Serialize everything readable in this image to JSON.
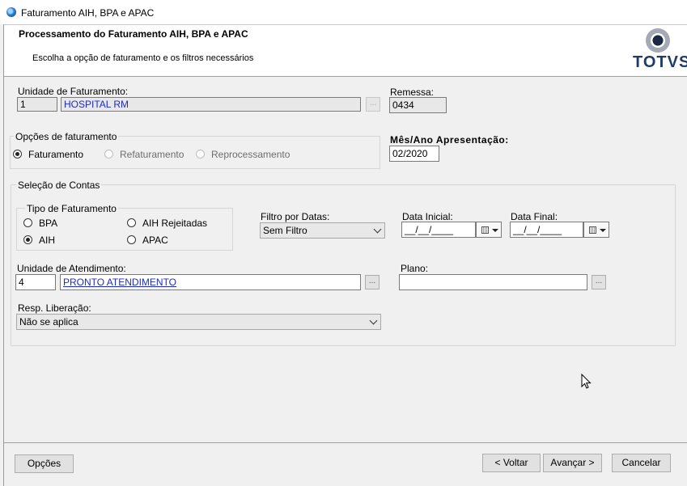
{
  "window": {
    "title": "Faturamento AIH, BPA e APAC",
    "app_icon": "totvs-app-icon"
  },
  "header": {
    "title": "Processamento do Faturamento AIH, BPA e APAC",
    "subtitle": "Escolha a opção de faturamento e os filtros necessários",
    "logo_text": "TOTVS",
    "logo_color": "#1f3b66"
  },
  "unidade_faturamento": {
    "label": "Unidade de Faturamento:",
    "code": "1",
    "name": "HOSPITAL RM",
    "lookup_label": "..."
  },
  "remessa": {
    "label": "Remessa:",
    "value": "0434"
  },
  "opcoes_faturamento": {
    "title": "Opções de faturamento",
    "options": [
      "Faturamento",
      "Refaturamento",
      "Reprocessamento"
    ],
    "selected": "Faturamento"
  },
  "mes_ano": {
    "label": "Mês/Ano Apresentação:",
    "value": "02/2020"
  },
  "selecao_contas": {
    "title": "Seleção de Contas",
    "tipo_faturamento": {
      "title": "Tipo de Faturamento",
      "options": [
        "BPA",
        "AIH Rejeitadas",
        "AIH",
        "APAC"
      ],
      "selected": "AIH"
    },
    "filtro_datas": {
      "label": "Filtro por Datas:",
      "value": "Sem Filtro"
    },
    "data_inicial": {
      "label": "Data Inicial:",
      "value": "__/__/____"
    },
    "data_final": {
      "label": "Data Final:",
      "value": "__/__/____"
    },
    "unidade_atendimento": {
      "label": "Unidade de Atendimento:",
      "code": "4",
      "name": "PRONTO ATENDIMENTO",
      "lookup_label": "..."
    },
    "plano": {
      "label": "Plano:",
      "value": "",
      "lookup_label": "..."
    },
    "resp_liberacao": {
      "label": "Resp. Liberação:",
      "value": "Não se aplica"
    }
  },
  "footer": {
    "opcoes": "Opções",
    "voltar": "< Voltar",
    "avancar": "Avançar >",
    "cancelar": "Cancelar"
  }
}
